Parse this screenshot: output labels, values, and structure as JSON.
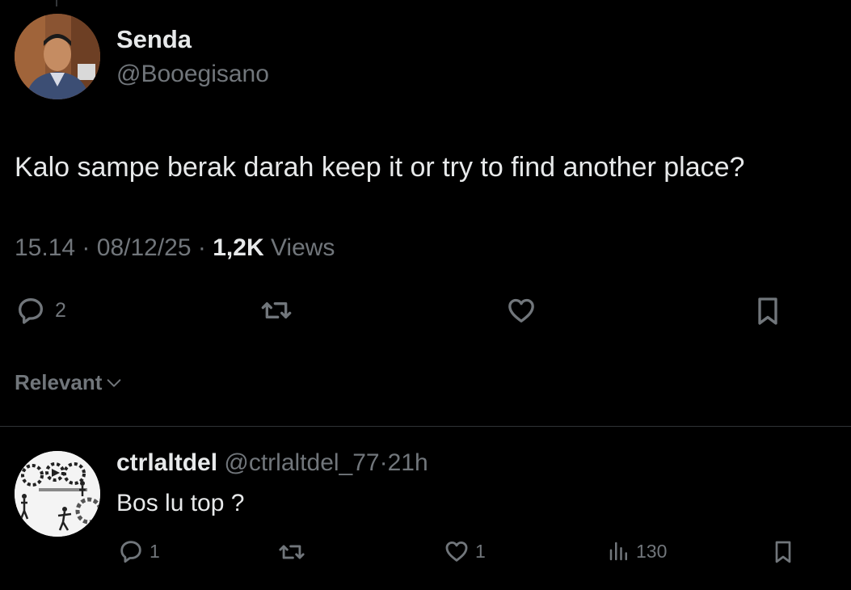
{
  "tweet": {
    "author_name": "Senda",
    "author_handle": "@Booegisano",
    "text": "Kalo sampe berak darah keep it or try to find another place?",
    "time": "15.14",
    "date": "08/12/25",
    "sep": "·",
    "views_count": "1,2K",
    "views_label": "Views",
    "actions": {
      "reply_icon": "reply-bubble-icon",
      "reply_count": "2",
      "retweet_icon": "retweet-icon",
      "like_icon": "heart-icon",
      "bookmark_icon": "bookmark-icon"
    }
  },
  "sort": {
    "label": "Relevant",
    "icon": "chevron-down-icon"
  },
  "reply": {
    "author_name": "ctrlaltdel",
    "author_handle": "@ctrlaltdel_77",
    "sep": "·",
    "time_ago": "21h",
    "text": "Bos lu top ?",
    "actions": {
      "reply_count": "1",
      "like_count": "1",
      "views_icon": "analytics-bars-icon",
      "views_count": "130"
    }
  },
  "colors": {
    "background": "#000000",
    "primary_text": "#e7e9ea",
    "secondary_text": "#71767b",
    "divider": "#2f3336"
  }
}
